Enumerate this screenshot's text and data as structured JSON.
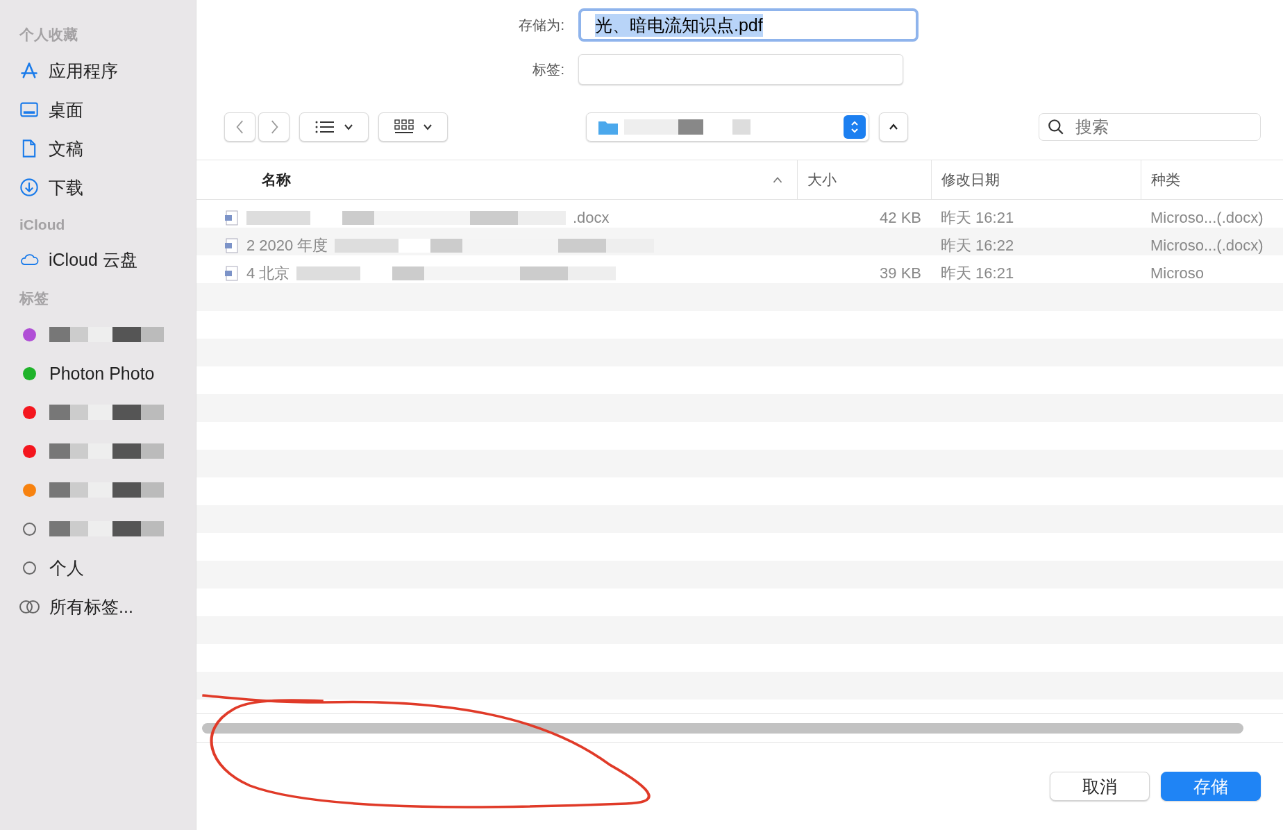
{
  "sidebar": {
    "sections": [
      {
        "title": "个人收藏",
        "items": [
          {
            "label": "应用程序",
            "kind": "apps"
          },
          {
            "label": "桌面",
            "kind": "desktop"
          },
          {
            "label": "文稿",
            "kind": "doc"
          },
          {
            "label": "下载",
            "kind": "download"
          }
        ]
      },
      {
        "title": "iCloud",
        "items": [
          {
            "label": "iCloud 云盘",
            "kind": "cloud"
          }
        ]
      }
    ],
    "tags_title": "标签",
    "tags": [
      {
        "kind": "redacted",
        "color": "#b04fd6"
      },
      {
        "kind": "text",
        "label": "Photon Photo",
        "color": "#1fb32a"
      },
      {
        "kind": "redacted",
        "color": "#f4161e"
      },
      {
        "kind": "redacted",
        "color": "#f4161e"
      },
      {
        "kind": "redacted",
        "color": "#f7820f"
      },
      {
        "kind": "redacted_hollow"
      },
      {
        "kind": "hollow",
        "label": "个人"
      },
      {
        "kind": "all",
        "label": "所有标签..."
      }
    ]
  },
  "save_as": {
    "label": "存储为:",
    "value": "光、暗电流知识点.pdf"
  },
  "tags_field": {
    "label": "标签:"
  },
  "search": {
    "placeholder": "搜索"
  },
  "table": {
    "columns": [
      {
        "label": "名称",
        "sorted": true
      },
      {
        "label": "大小",
        "sorted": false
      },
      {
        "label": "修改日期",
        "sorted": false
      },
      {
        "label": "种类",
        "sorted": false
      }
    ],
    "rows": [
      {
        "name": ".docx",
        "size": "42 KB",
        "date": "昨天 16:21",
        "kind": "Microso...(.docx)"
      },
      {
        "name": "2 2020 年度",
        "date": "昨天 16:22",
        "kind": "Microso...(.docx)"
      },
      {
        "name": "4 北京",
        "size": "39 KB",
        "date": "昨天 16:21",
        "kind": "Microso"
      }
    ]
  },
  "buttons": [
    {
      "label": "取消",
      "primary": false
    },
    {
      "label": "存储",
      "primary": true
    }
  ]
}
